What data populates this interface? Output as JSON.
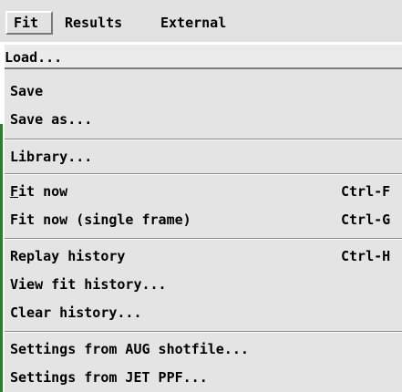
{
  "menubar": {
    "items": [
      {
        "label": "Fit"
      },
      {
        "label": "Results"
      },
      {
        "label": "External"
      }
    ]
  },
  "menu": {
    "load": "Load...",
    "save": "Save",
    "save_as": "Save as...",
    "library": "Library...",
    "fit_now_mnemonic": "F",
    "fit_now_rest": "it now",
    "fit_now_shortcut": "Ctrl-F",
    "fit_single": "Fit now (single frame)",
    "fit_single_shortcut": "Ctrl-G",
    "replay": "Replay history",
    "replay_shortcut": "Ctrl-H",
    "view_history": "View fit history...",
    "clear_history": "Clear history...",
    "aug": "Settings from AUG shotfile...",
    "jet": "Settings from JET PPF..."
  },
  "colors": {
    "menu_bg": "#e4e4e4",
    "menubar_bg": "#e2e2e2",
    "left_accent": "#2e7d32"
  }
}
